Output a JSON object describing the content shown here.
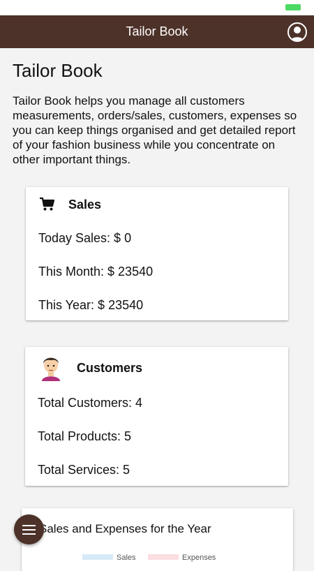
{
  "app": {
    "title": "Tailor Book"
  },
  "page": {
    "heading": "Tailor Book",
    "intro": "Tailor Book helps you manage all customers measurements, orders/sales, customers, expenses so you can keep things organised and get detailed report of your fashion business while you concentrate on other important things."
  },
  "sales_card": {
    "icon": "shopping-cart-icon",
    "title": "Sales",
    "today": "Today Sales: $ 0",
    "month": "This Month: $ 23540",
    "year": "This Year: $ 23540"
  },
  "customers_card": {
    "icon": "customer-avatar-icon",
    "title": "Customers",
    "total_customers": "Total Customers: 4",
    "total_products": "Total Products: 5",
    "total_services": "Total Services: 5"
  },
  "chart_card": {
    "title": "Sales and Expenses for the Year",
    "legend": [
      {
        "label": "Sales",
        "color": "#d6eaf8"
      },
      {
        "label": "Expenses",
        "color": "#fbdde2"
      }
    ]
  },
  "fab": {
    "icon": "menu-icon"
  },
  "colors": {
    "primary": "#4d3229",
    "background": "#f3f3f3",
    "status_battery": "#4cd964"
  }
}
